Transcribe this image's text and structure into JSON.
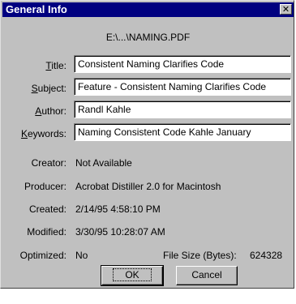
{
  "dialog": {
    "title": "General Info",
    "close_glyph": "✕",
    "filename": "E:\\...\\NAMING.PDF"
  },
  "fields": {
    "title": {
      "label_ul": "T",
      "label_rest": "itle:",
      "value": "Consistent Naming Clarifies Code"
    },
    "subject": {
      "label_ul": "S",
      "label_rest": "ubject:",
      "value": "Feature - Consistent Naming Clarifies Code"
    },
    "author": {
      "label_ul": "A",
      "label_rest": "uthor:",
      "value": "Randl Kahle"
    },
    "keywords": {
      "label_ul": "K",
      "label_rest": "eywords:",
      "value": "Naming Consistent Code Kahle January"
    }
  },
  "info": {
    "creator_label": "Creator:",
    "creator_value": "Not Available",
    "producer_label": "Producer:",
    "producer_value": "Acrobat Distiller 2.0 for Macintosh",
    "created_label": "Created:",
    "created_value": "2/14/95 4:58:10 PM",
    "modified_label": "Modified:",
    "modified_value": "3/30/95 10:28:07 AM",
    "optimized_label": "Optimized:",
    "optimized_value": "No",
    "filesize_label": "File Size (Bytes):",
    "filesize_value": "624328"
  },
  "buttons": {
    "ok_label": "OK",
    "cancel_label": "Cancel"
  }
}
